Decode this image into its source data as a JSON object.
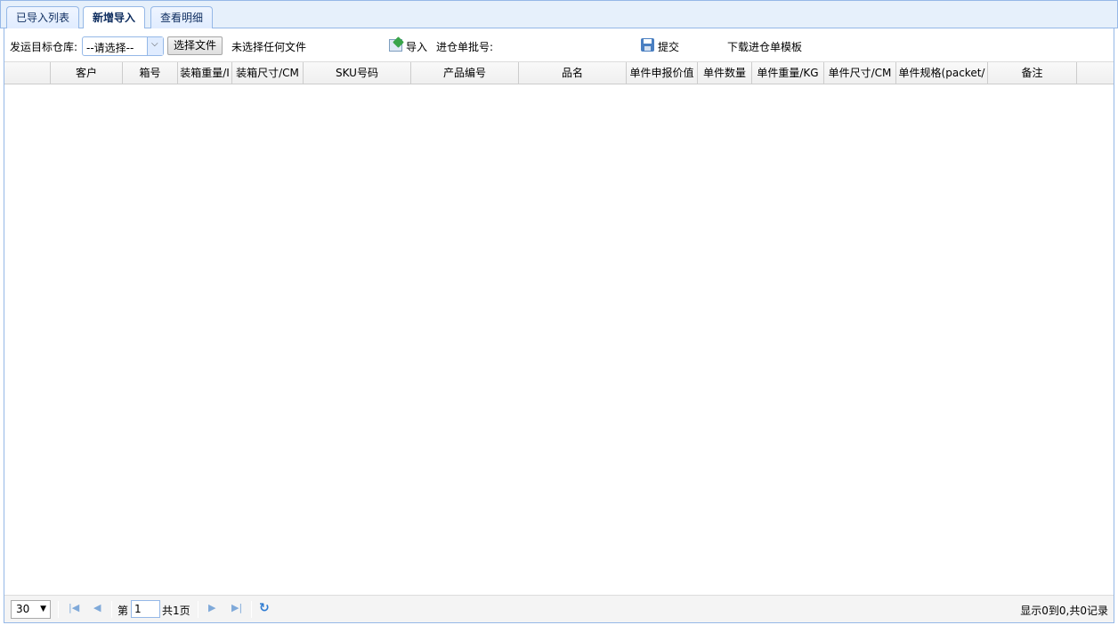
{
  "tabs": [
    {
      "label": "已导入列表",
      "active": false
    },
    {
      "label": "新增导入",
      "active": true
    },
    {
      "label": "查看明细",
      "active": false
    }
  ],
  "toolbar": {
    "warehouse_label": "发运目标仓库:",
    "warehouse_value": "--请选择--",
    "choose_file_label": "选择文件",
    "no_file_text": "未选择任何文件",
    "import_label": "导入",
    "batch_label": "进仓单批号:",
    "submit_label": "提交",
    "download_template_label": "下载进仓单模板"
  },
  "grid": {
    "columns": [
      "客户",
      "箱号",
      "装箱重量/I",
      "装箱尺寸/CM",
      "SKU号码",
      "产品编号",
      "品名",
      "单件申报价值",
      "单件数量",
      "单件重量/KG",
      "单件尺寸/CM",
      "单件规格(packet/",
      "备注"
    ]
  },
  "pager": {
    "page_size": "30",
    "page_prefix": "第",
    "page_number": "1",
    "total_pages": "共1页",
    "summary": "显示0到0,共0记录"
  },
  "colors": {
    "border": "#95b8e7",
    "tab_bg": "#e6f0fb",
    "accent": "#2d7bd2"
  }
}
